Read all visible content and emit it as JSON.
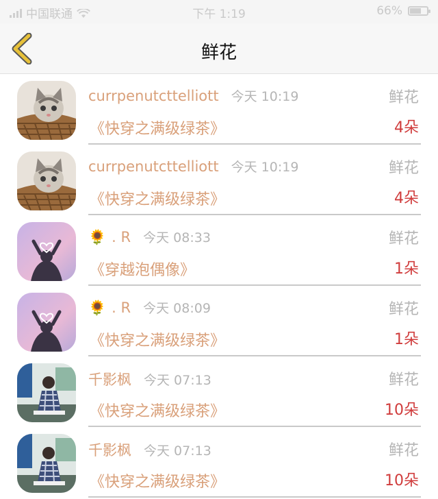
{
  "status": {
    "carrier": "中国联通",
    "time": "下午 1:19",
    "battery": "66%",
    "battery_level": 0.66
  },
  "nav": {
    "title": "鲜花",
    "back_icon": "chevron-left-icon",
    "accent": "#e7c13a"
  },
  "colors": {
    "name": "#d9a07a",
    "meta": "#b5b5b5",
    "count": "#d03c3c"
  },
  "rows": [
    {
      "name": "currpenutcttelliott",
      "prefix": "",
      "time": "今天 10:19",
      "gift": "鲜花",
      "book": "《快穿之满级绿茶》",
      "count": "4朵",
      "avatar": "cat"
    },
    {
      "name": "currpenutcttelliott",
      "prefix": "",
      "time": "今天 10:19",
      "gift": "鲜花",
      "book": "《快穿之满级绿茶》",
      "count": "4朵",
      "avatar": "cat"
    },
    {
      "name": ". R",
      "prefix": "🌻",
      "time": "今天 08:33",
      "gift": "鲜花",
      "book": "《穿越泡偶像》",
      "count": "1朵",
      "avatar": "heart"
    },
    {
      "name": ". R",
      "prefix": "🌻",
      "time": "今天 08:09",
      "gift": "鲜花",
      "book": "《快穿之满级绿茶》",
      "count": "1朵",
      "avatar": "heart"
    },
    {
      "name": "千影枫",
      "prefix": "",
      "time": "今天 07:13",
      "gift": "鲜花",
      "book": "《快穿之满级绿茶》",
      "count": "10朵",
      "avatar": "person"
    },
    {
      "name": "千影枫",
      "prefix": "",
      "time": "今天 07:13",
      "gift": "鲜花",
      "book": "《快穿之满级绿茶》",
      "count": "10朵",
      "avatar": "person"
    }
  ]
}
